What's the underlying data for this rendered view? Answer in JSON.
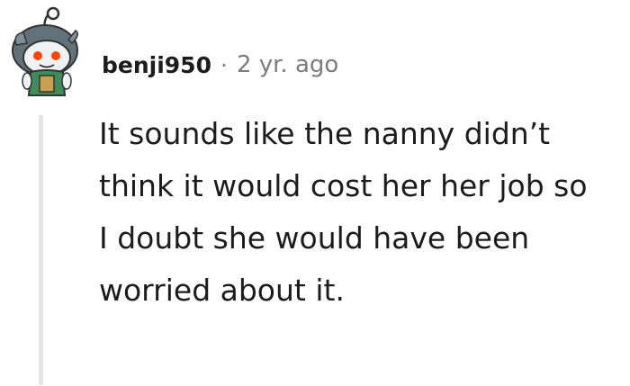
{
  "comment": {
    "username": "benji950",
    "separator": "·",
    "timestamp": "2 yr. ago",
    "body": "It sounds like the nanny didn’t think it would cost her her job so I doubt she would have been worried about it."
  },
  "avatar": {
    "icon": "snoo-avatar-icon",
    "colors": {
      "head": "#e4e9ec",
      "hat": "#62727a",
      "eyes": "#ff4500",
      "body": "#3e8b5c"
    }
  },
  "colors": {
    "text": "#1c1c1c",
    "meta": "#7c7c7c",
    "thread_line": "#e6e6e6"
  }
}
